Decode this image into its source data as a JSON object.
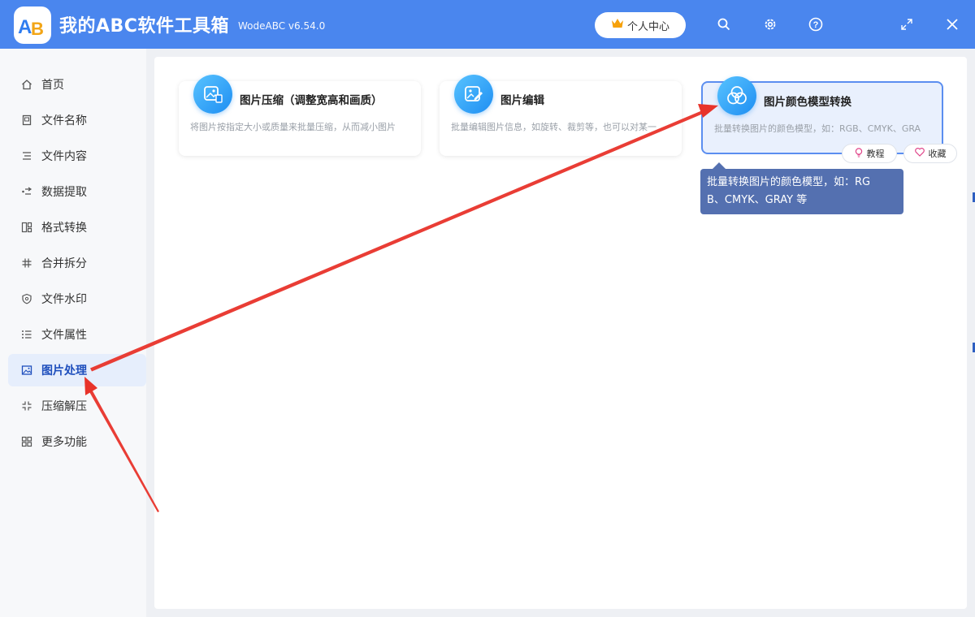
{
  "app": {
    "logo_text": "AB",
    "title": "我的ABC软件工具箱",
    "version": "WodeABC v6.54.0",
    "user_center": "个人中心"
  },
  "sidebar": {
    "items": [
      {
        "label": "首页",
        "icon": "home-icon"
      },
      {
        "label": "文件名称",
        "icon": "file-name-icon"
      },
      {
        "label": "文件内容",
        "icon": "file-content-icon"
      },
      {
        "label": "数据提取",
        "icon": "data-extract-icon"
      },
      {
        "label": "格式转换",
        "icon": "format-convert-icon"
      },
      {
        "label": "合并拆分",
        "icon": "merge-split-icon"
      },
      {
        "label": "文件水印",
        "icon": "watermark-icon"
      },
      {
        "label": "文件属性",
        "icon": "file-properties-icon"
      },
      {
        "label": "图片处理",
        "icon": "image-icon"
      },
      {
        "label": "压缩解压",
        "icon": "compress-icon"
      },
      {
        "label": "更多功能",
        "icon": "more-features-icon"
      }
    ],
    "active_index": 8
  },
  "cards": [
    {
      "title": "图片压缩（调整宽高和画质）",
      "desc": "将图片按指定大小或质量来批量压缩，从而减小图片",
      "icon": "image-compress-icon"
    },
    {
      "title": "图片编辑",
      "desc": "批量编辑图片信息，如旋转、裁剪等，也可以对某一",
      "icon": "image-edit-icon"
    },
    {
      "title": "图片颜色模型转换",
      "desc": "批量转换图片的颜色模型，如：RGB、CMYK、GRA",
      "icon": "color-model-icon"
    }
  ],
  "card_actions": {
    "tutorial": "教程",
    "favorite": "收藏"
  },
  "tooltip": {
    "line1": "批量转换图片的颜色模型，如：RG",
    "line2": "B、CMYK、GRAY 等"
  },
  "colors": {
    "titlebar": "#4a86ee",
    "active_nav_bg": "#e6eefc",
    "tooltip_bg": "#5470b0",
    "annotation_arrow": "#e8332a"
  }
}
